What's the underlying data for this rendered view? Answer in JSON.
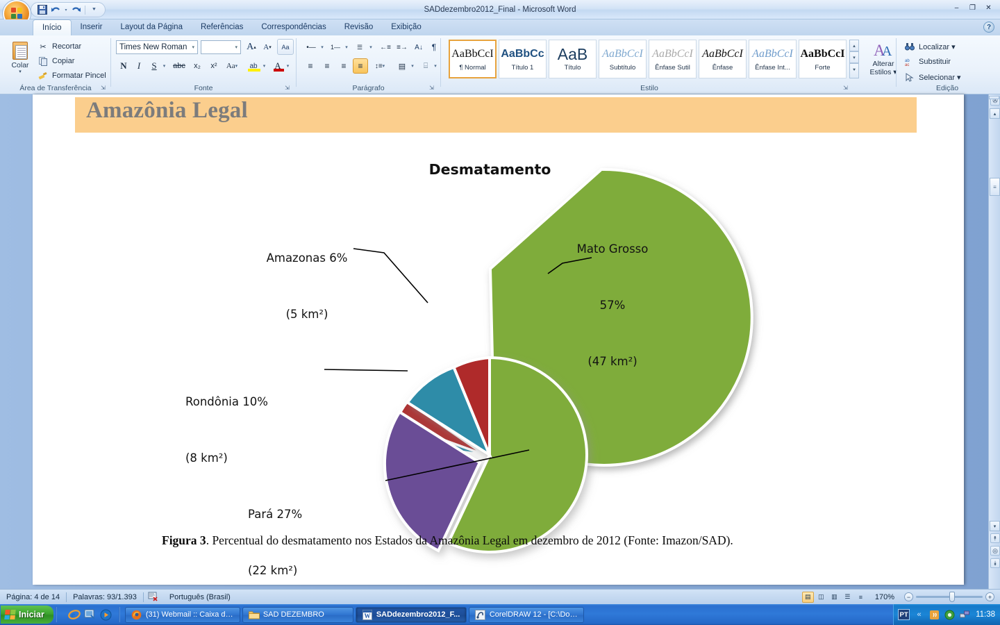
{
  "window": {
    "title": "SADdezembro2012_Final - Microsoft Word",
    "minimize_label": "–",
    "restore_label": "❐",
    "close_label": "✕"
  },
  "quick_access": {
    "save_icon": "save-icon",
    "undo_icon": "undo-icon",
    "redo_icon": "redo-icon",
    "customize_icon": "customize-qat-icon"
  },
  "ribbon": {
    "tabs": [
      {
        "label": "Início",
        "active": true
      },
      {
        "label": "Inserir",
        "active": false
      },
      {
        "label": "Layout da Página",
        "active": false
      },
      {
        "label": "Referências",
        "active": false
      },
      {
        "label": "Correspondências",
        "active": false
      },
      {
        "label": "Revisão",
        "active": false
      },
      {
        "label": "Exibição",
        "active": false
      }
    ],
    "help_label": "?",
    "groups": {
      "clipboard": {
        "label": "Área de Transferência",
        "paste_label": "Colar",
        "paste_arrow": "▾",
        "items": [
          {
            "label": "Recortar",
            "icon": "scissors-icon"
          },
          {
            "label": "Copiar",
            "icon": "copy-icon"
          },
          {
            "label": "Formatar Pincel",
            "icon": "format-painter-icon"
          }
        ]
      },
      "font": {
        "label": "Fonte",
        "font_name": "Times New Roman",
        "font_size": "",
        "grow_label": "A",
        "shrink_label": "A",
        "clear_format_label": "Aa",
        "bold_label": "N",
        "italic_label": "I",
        "underline_label": "S",
        "strike_label": "abc",
        "subscript_label": "x₂",
        "superscript_label": "x²",
        "case_label": "Aa",
        "highlight_label": "ab",
        "fontcolor_label": "A"
      },
      "paragraph": {
        "label": "Parágrafo",
        "bullets_label": "•—",
        "numbering_label": "1—",
        "multilevel_label": "☰",
        "dec_indent_label": "←≡",
        "inc_indent_label": "≡→",
        "sort_label": "A↓",
        "marks_label": "¶",
        "align_left_label": "≡",
        "align_center_label": "≡",
        "align_right_label": "≡",
        "justify_label": "≡",
        "linespacing_label": "↕≡",
        "shading_label": "▤",
        "borders_label": "⌸"
      },
      "styles": {
        "label": "Estilo",
        "items": [
          {
            "preview": "AaBbCcI",
            "name": "¶ Normal",
            "selected": true,
            "style": "normal"
          },
          {
            "preview": "AaBbCc",
            "name": "Título 1",
            "selected": false,
            "style": "heading1"
          },
          {
            "preview": "AaB",
            "name": "Título",
            "selected": false,
            "style": "title"
          },
          {
            "preview": "AaBbCcI",
            "name": "Subtítulo",
            "selected": false,
            "style": "subtitle"
          },
          {
            "preview": "AaBbCcI",
            "name": "Ênfase Sutil",
            "selected": false,
            "style": "subtle"
          },
          {
            "preview": "AaBbCcI",
            "name": "Ênfase",
            "selected": false,
            "style": "emphasis"
          },
          {
            "preview": "AaBbCcI",
            "name": "Ênfase Int...",
            "selected": false,
            "style": "intense"
          },
          {
            "preview": "AaBbCcI",
            "name": "Forte",
            "selected": false,
            "style": "strong"
          }
        ],
        "change_styles_line1": "Alterar",
        "change_styles_line2": "Estilos ▾"
      },
      "editing": {
        "label": "Edição",
        "items": [
          {
            "label": "Localizar ▾",
            "icon": "binoculars-icon"
          },
          {
            "label": "Substituir",
            "icon": "replace-icon"
          },
          {
            "label": "Selecionar ▾",
            "icon": "select-cursor-icon"
          }
        ]
      }
    }
  },
  "document": {
    "heading_band": "Amazônia Legal",
    "caption_bold": "Figura 3",
    "caption_rest": ". Percentual do desmatamento nos Estados da Amazônia Legal em dezembro de 2012 (Fonte: Imazon/SAD)."
  },
  "chart_data": {
    "type": "pie",
    "title": "Desmatamento",
    "xlabel": "",
    "ylabel": "",
    "categories": [
      "Mato Grosso",
      "Pará",
      "Rondônia",
      "Amazonas"
    ],
    "values": [
      57,
      27,
      10,
      6
    ],
    "value_unit": "%",
    "areas_km2": [
      47,
      22,
      8,
      5
    ],
    "labels": [
      {
        "name": "Mato Grosso",
        "line1": "Mato Grosso",
        "line2": "57%",
        "line3": "(47 km²)",
        "color": "#7FAC3B",
        "percent": 57,
        "area": "47 km²"
      },
      {
        "name": "Pará",
        "line1": "Pará 27%",
        "line2": "(22 km²)",
        "line3": "",
        "color": "#6B4D96",
        "percent": 27,
        "area": "22 km²"
      },
      {
        "name": "Rondônia",
        "line1": "Rondônia 10%",
        "line2": "(8 km²)",
        "line3": "",
        "color": "#2D8CA8",
        "percent": 10,
        "area": "8 km²"
      },
      {
        "name": "Amazonas",
        "line1": "Amazonas 6%",
        "line2": "(5 km²)",
        "line3": "",
        "color": "#AF2B2B",
        "percent": 6,
        "area": "5 km²"
      }
    ],
    "exploded_slice": "Pará",
    "legend": "none",
    "grid": false
  },
  "statusbar": {
    "page": "Página: 4 de 14",
    "words": "Palavras: 93/1.393",
    "proof_icon": "proofing-errors-icon",
    "language": "Português (Brasil)",
    "zoom": "170%",
    "zoom_out_label": "−",
    "zoom_in_label": "+",
    "views": [
      {
        "name": "print-layout",
        "glyph": "▤",
        "selected": true
      },
      {
        "name": "full-screen-reading",
        "glyph": "◫",
        "selected": false
      },
      {
        "name": "web-layout",
        "glyph": "▥",
        "selected": false
      },
      {
        "name": "outline",
        "glyph": "☰",
        "selected": false
      },
      {
        "name": "draft",
        "glyph": "≡",
        "selected": false
      }
    ]
  },
  "taskbar": {
    "start_label": "Iniciar",
    "quick_launch": [
      {
        "name": "internet-explorer-icon",
        "glyph": "e"
      },
      {
        "name": "show-desktop-icon",
        "glyph": "▣"
      },
      {
        "name": "media-player-icon",
        "glyph": "▶"
      }
    ],
    "tasks": [
      {
        "label": "(31) Webmail :: Caixa de...",
        "icon": "firefox-icon",
        "active": false
      },
      {
        "label": "SAD DEZEMBRO",
        "icon": "folder-icon",
        "active": false
      },
      {
        "label": "SADdezembro2012_F...",
        "icon": "word-icon",
        "active": true
      },
      {
        "label": "CorelDRAW 12 - [C:\\Doc...",
        "icon": "coreldraw-icon",
        "active": false
      }
    ],
    "tray": {
      "language": "PT",
      "expand_label": "«",
      "icons": [
        {
          "name": "java-icon",
          "glyph": "☕"
        },
        {
          "name": "antivirus-icon",
          "glyph": "◉"
        },
        {
          "name": "network-icon",
          "glyph": "⎙"
        }
      ],
      "clock": "11:38"
    }
  }
}
